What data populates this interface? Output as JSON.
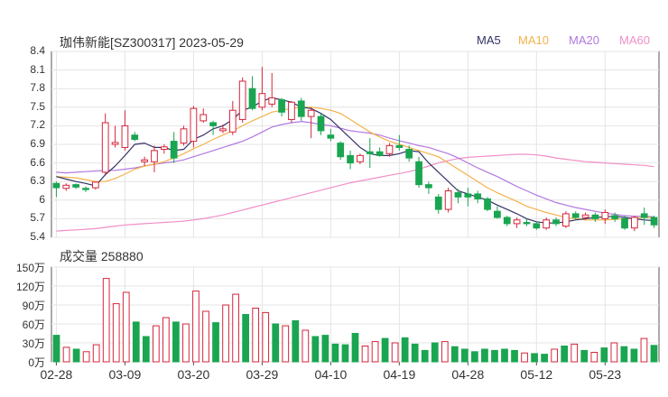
{
  "header": {
    "title": "珈伟新能[SZ300317] 2023-05-29"
  },
  "legend": [
    {
      "label": "MA5",
      "color": "#333366"
    },
    {
      "label": "MA10",
      "color": "#f4b24a"
    },
    {
      "label": "MA20",
      "color": "#b278e0"
    },
    {
      "label": "MA60",
      "color": "#f08fc6"
    }
  ],
  "volume": {
    "title": "成交量 258880"
  },
  "colors": {
    "up": "#d6263c",
    "down": "#1aa551",
    "grid": "#e4e4e4",
    "axis": "#555555"
  },
  "chart_data": [
    {
      "type": "candlestick",
      "y_ticks": [
        "8.4",
        "8.1",
        "7.8",
        "7.5",
        "7.2",
        "6.9",
        "6.6",
        "6.3",
        "6",
        "5.7",
        "5.4"
      ],
      "ylim": [
        5.4,
        8.4
      ],
      "x_ticks": [
        {
          "label": "02-28",
          "index": 0
        },
        {
          "label": "03-09",
          "index": 7
        },
        {
          "label": "03-20",
          "index": 14
        },
        {
          "label": "03-29",
          "index": 21
        },
        {
          "label": "04-10",
          "index": 28
        },
        {
          "label": "04-19",
          "index": 35
        },
        {
          "label": "04-28",
          "index": 42
        },
        {
          "label": "05-12",
          "index": 49
        },
        {
          "label": "05-23",
          "index": 56
        }
      ],
      "candles": [
        [
          6.27,
          6.2,
          6.3,
          6.05
        ],
        [
          6.19,
          6.24,
          6.27,
          6.15
        ],
        [
          6.25,
          6.21,
          6.27,
          6.18
        ],
        [
          6.19,
          6.17,
          6.22,
          6.13
        ],
        [
          6.2,
          6.29,
          6.3,
          6.17
        ],
        [
          6.45,
          7.25,
          7.4,
          6.42
        ],
        [
          6.9,
          6.93,
          7.2,
          6.85
        ],
        [
          6.85,
          7.2,
          7.45,
          6.8
        ],
        [
          7.05,
          6.98,
          7.1,
          6.95
        ],
        [
          6.62,
          6.65,
          6.7,
          6.55
        ],
        [
          6.62,
          6.8,
          6.88,
          6.45
        ],
        [
          6.82,
          6.86,
          6.9,
          6.75
        ],
        [
          6.95,
          6.68,
          7.1,
          6.6
        ],
        [
          6.92,
          7.15,
          7.2,
          6.88
        ],
        [
          6.95,
          7.48,
          7.52,
          6.85
        ],
        [
          7.28,
          7.38,
          7.48,
          7.25
        ],
        [
          7.25,
          7.2,
          7.28,
          7.05
        ],
        [
          7.12,
          7.15,
          7.22,
          7.08
        ],
        [
          7.1,
          7.45,
          7.6,
          7.05
        ],
        [
          7.3,
          7.92,
          7.98,
          7.25
        ],
        [
          7.8,
          7.48,
          8.0,
          7.45
        ],
        [
          7.5,
          7.72,
          8.15,
          7.45
        ],
        [
          7.55,
          7.65,
          8.05,
          7.5
        ],
        [
          7.62,
          7.42,
          7.65,
          7.35
        ],
        [
          7.3,
          7.58,
          7.6,
          7.25
        ],
        [
          7.6,
          7.35,
          7.65,
          7.28
        ],
        [
          7.35,
          7.45,
          7.5,
          7.0
        ],
        [
          7.35,
          7.12,
          7.4,
          7.05
        ],
        [
          7.05,
          7.0,
          7.15,
          6.95
        ],
        [
          6.92,
          6.7,
          6.95,
          6.65
        ],
        [
          6.72,
          6.6,
          6.8,
          6.5
        ],
        [
          6.62,
          6.72,
          6.75,
          6.58
        ],
        [
          6.78,
          6.75,
          7.0,
          6.52
        ],
        [
          6.78,
          6.72,
          6.85,
          6.7
        ],
        [
          6.75,
          6.88,
          6.92,
          6.7
        ],
        [
          6.88,
          6.85,
          7.05,
          6.8
        ],
        [
          6.82,
          6.68,
          6.88,
          6.62
        ],
        [
          6.62,
          6.25,
          6.7,
          6.2
        ],
        [
          6.25,
          6.2,
          6.3,
          6.1
        ],
        [
          6.05,
          5.85,
          6.1,
          5.78
        ],
        [
          5.85,
          6.15,
          6.2,
          5.8
        ],
        [
          6.12,
          6.05,
          6.18,
          5.95
        ],
        [
          6.1,
          6.05,
          6.2,
          5.9
        ],
        [
          6.1,
          6.02,
          6.15,
          5.95
        ],
        [
          6.02,
          5.85,
          6.05,
          5.82
        ],
        [
          5.82,
          5.72,
          5.9,
          5.7
        ],
        [
          5.72,
          5.62,
          5.75,
          5.58
        ],
        [
          5.62,
          5.68,
          5.72,
          5.55
        ],
        [
          5.64,
          5.62,
          5.7,
          5.58
        ],
        [
          5.62,
          5.55,
          5.65,
          5.52
        ],
        [
          5.55,
          5.68,
          5.72,
          5.52
        ],
        [
          5.68,
          5.62,
          5.72,
          5.58
        ],
        [
          5.58,
          5.78,
          5.82,
          5.55
        ],
        [
          5.78,
          5.72,
          5.82,
          5.68
        ],
        [
          5.72,
          5.76,
          5.8,
          5.68
        ],
        [
          5.76,
          5.7,
          5.8,
          5.65
        ],
        [
          5.7,
          5.8,
          5.85,
          5.62
        ],
        [
          5.75,
          5.7,
          5.8,
          5.65
        ],
        [
          5.7,
          5.55,
          5.75,
          5.52
        ],
        [
          5.55,
          5.72,
          5.75,
          5.5
        ],
        [
          5.78,
          5.72,
          5.88,
          5.6
        ],
        [
          5.72,
          5.6,
          5.75,
          5.55
        ]
      ],
      "ma5": [
        6.38,
        6.34,
        6.3,
        6.27,
        6.23,
        6.41,
        6.55,
        6.72,
        6.9,
        6.92,
        6.85,
        6.85,
        6.8,
        6.82,
        6.98,
        7.05,
        7.15,
        7.2,
        7.3,
        7.45,
        7.5,
        7.6,
        7.65,
        7.62,
        7.58,
        7.5,
        7.48,
        7.4,
        7.3,
        7.15,
        7.0,
        6.85,
        6.75,
        6.72,
        6.72,
        6.75,
        6.8,
        6.78,
        6.6,
        6.45,
        6.3,
        6.15,
        6.1,
        6.05,
        6.0,
        5.92,
        5.85,
        5.78,
        5.7,
        5.65,
        5.63,
        5.63,
        5.65,
        5.68,
        5.7,
        5.72,
        5.73,
        5.74,
        5.72,
        5.7,
        5.68,
        5.67
      ],
      "ma10": [
        6.38,
        6.37,
        6.36,
        6.33,
        6.3,
        6.3,
        6.35,
        6.42,
        6.5,
        6.55,
        6.58,
        6.62,
        6.68,
        6.75,
        6.83,
        6.9,
        6.98,
        7.05,
        7.12,
        7.2,
        7.28,
        7.35,
        7.42,
        7.45,
        7.48,
        7.5,
        7.5,
        7.48,
        7.45,
        7.4,
        7.3,
        7.2,
        7.1,
        7.02,
        6.95,
        6.9,
        6.85,
        6.8,
        6.75,
        6.7,
        6.6,
        6.5,
        6.4,
        6.3,
        6.2,
        6.12,
        6.05,
        5.98,
        5.9,
        5.85,
        5.8,
        5.76,
        5.72,
        5.7,
        5.68,
        5.68,
        5.68,
        5.69,
        5.7,
        5.71,
        5.72,
        5.72
      ],
      "ma20": [
        6.45,
        6.44,
        6.45,
        6.46,
        6.47,
        6.48,
        6.48,
        6.5,
        6.52,
        6.55,
        6.58,
        6.6,
        6.62,
        6.65,
        6.7,
        6.75,
        6.8,
        6.85,
        6.9,
        6.95,
        7.02,
        7.1,
        7.18,
        7.22,
        7.25,
        7.27,
        7.25,
        7.22,
        7.2,
        7.16,
        7.12,
        7.1,
        7.08,
        7.05,
        7.0,
        6.96,
        6.92,
        6.88,
        6.85,
        6.8,
        6.75,
        6.68,
        6.6,
        6.52,
        6.45,
        6.38,
        6.3,
        6.22,
        6.15,
        6.08,
        6.02,
        5.96,
        5.92,
        5.88,
        5.85,
        5.82,
        5.79,
        5.77,
        5.75,
        5.74,
        5.74,
        5.73
      ],
      "ma60": [
        5.5,
        5.51,
        5.52,
        5.53,
        5.54,
        5.56,
        5.58,
        5.6,
        5.61,
        5.62,
        5.63,
        5.64,
        5.65,
        5.66,
        5.68,
        5.7,
        5.73,
        5.76,
        5.8,
        5.84,
        5.88,
        5.92,
        5.96,
        6.0,
        6.04,
        6.08,
        6.12,
        6.16,
        6.2,
        6.24,
        6.28,
        6.31,
        6.34,
        6.37,
        6.4,
        6.43,
        6.46,
        6.5,
        6.55,
        6.6,
        6.64,
        6.67,
        6.69,
        6.7,
        6.71,
        6.72,
        6.73,
        6.74,
        6.74,
        6.73,
        6.71,
        6.68,
        6.66,
        6.64,
        6.62,
        6.61,
        6.6,
        6.59,
        6.58,
        6.57,
        6.56,
        6.54
      ]
    },
    {
      "type": "bar",
      "title": "成交量 258880",
      "y_ticks": [
        "150万",
        "120万",
        "90万",
        "60万",
        "30万",
        "0万"
      ],
      "ylim": [
        0,
        150
      ],
      "unit": "万",
      "values": [
        42,
        23,
        20,
        16,
        27,
        132,
        92,
        110,
        63,
        40,
        57,
        70,
        63,
        60,
        112,
        80,
        62,
        90,
        107,
        75,
        85,
        78,
        60,
        57,
        65,
        50,
        40,
        42,
        28,
        27,
        45,
        25,
        32,
        37,
        30,
        38,
        28,
        18,
        30,
        32,
        24,
        20,
        16,
        20,
        18,
        20,
        18,
        14,
        13,
        12,
        20,
        25,
        28,
        18,
        15,
        22,
        30,
        24,
        20,
        37,
        26
      ],
      "up": [
        false,
        true,
        false,
        true,
        true,
        true,
        true,
        true,
        false,
        false,
        true,
        true,
        false,
        true,
        true,
        true,
        false,
        true,
        true,
        false,
        true,
        true,
        false,
        true,
        false,
        true,
        false,
        false,
        false,
        false,
        false,
        true,
        true,
        false,
        true,
        false,
        false,
        false,
        false,
        true,
        false,
        false,
        false,
        false,
        false,
        false,
        false,
        true,
        false,
        false,
        true,
        false,
        true,
        false,
        true,
        false,
        true,
        false,
        false,
        true,
        false
      ]
    }
  ]
}
